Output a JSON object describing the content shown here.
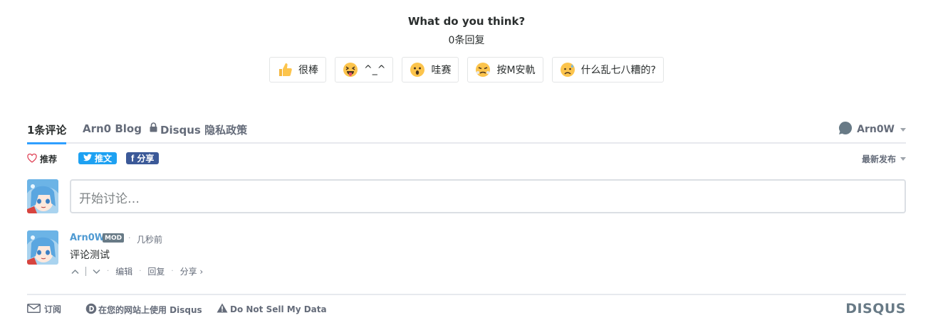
{
  "reactions_header": {
    "title": "What do you think?",
    "count": "0条回复"
  },
  "reactions": [
    {
      "icon": "thumbs-up-icon",
      "label": "很棒"
    },
    {
      "icon": "tongue-out-face-icon",
      "label": "^_^"
    },
    {
      "icon": "astonished-face-icon",
      "label": "哇赛"
    },
    {
      "icon": "steaming-face-icon",
      "label": "按M安軌"
    },
    {
      "icon": "sad-sweat-face-icon",
      "label": "什么乱七八糟的?"
    }
  ],
  "nav": {
    "comments_tab": "1条评论",
    "blog_tab": "Arn0 Blog",
    "privacy_tab": "Disqus 隐私政策",
    "user_name": "Arn0W"
  },
  "toolbar": {
    "recommend": "推荐",
    "tweet": "推文",
    "share": "分享",
    "sort": "最新发布"
  },
  "composer": {
    "placeholder": "开始讨论…"
  },
  "comment": {
    "author": "Arn0W",
    "badge": "MOD",
    "separator": "·",
    "time": "几秒前",
    "text": "评论测试",
    "actions": {
      "edit": "编辑",
      "reply": "回复",
      "share": "分享 ›"
    }
  },
  "footer": {
    "subscribe": "订阅",
    "use_disqus": "在您的网站上使用 Disqus",
    "do_not_sell": "Do Not Sell My Data",
    "logo": "DISQUS"
  },
  "colors": {
    "accent": "#2e9fff",
    "author_link": "#4f9ad2",
    "twitter": "#1da1f2",
    "facebook": "#3b5998",
    "mod_badge": "#687a86"
  }
}
